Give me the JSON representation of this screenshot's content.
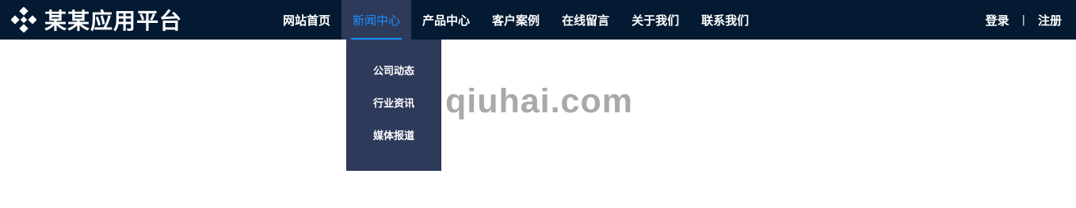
{
  "header": {
    "brand_name": "某某应用平台",
    "logo_icon": "diamond-cluster-logo"
  },
  "nav": {
    "items": [
      {
        "label": "网站首页"
      },
      {
        "label": "新闻中心",
        "active": true
      },
      {
        "label": "产品中心"
      },
      {
        "label": "客户案例"
      },
      {
        "label": "在线留言"
      },
      {
        "label": "关于我们"
      },
      {
        "label": "联系我们"
      }
    ]
  },
  "dropdown": {
    "items": [
      {
        "label": "公司动态"
      },
      {
        "label": "行业资讯"
      },
      {
        "label": "媒体报道"
      }
    ]
  },
  "auth": {
    "login": "登录",
    "separator": "|",
    "register": "注册"
  },
  "watermark": "qiuhai.com",
  "colors": {
    "header_bg": "#041a32",
    "active_bg": "#2e3a5a",
    "accent": "#1e90ff"
  }
}
